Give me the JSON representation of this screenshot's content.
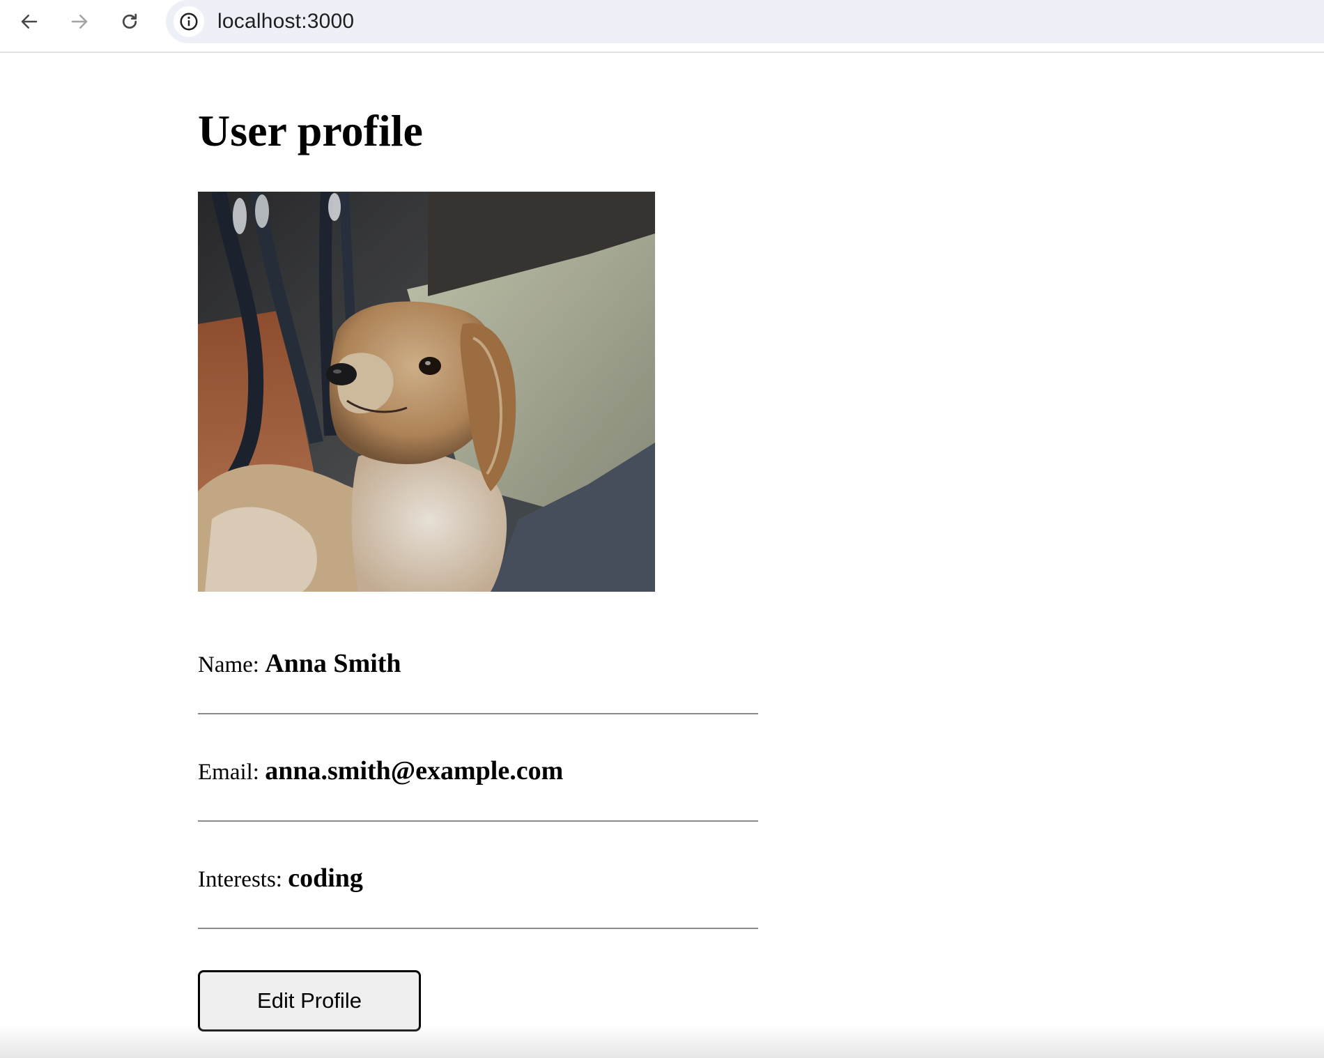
{
  "browser": {
    "url": "localhost:3000",
    "back_icon": "arrow-left-icon",
    "forward_icon": "arrow-right-icon",
    "reload_icon": "reload-icon",
    "site_info_icon": "info-icon"
  },
  "page": {
    "title": "User profile",
    "avatar_subject": "dog-photo",
    "fields": [
      {
        "label": "Name:",
        "value": "Anna Smith"
      },
      {
        "label": "Email:",
        "value": "anna.smith@example.com"
      },
      {
        "label": "Interests:",
        "value": "coding"
      }
    ],
    "edit_button_label": "Edit Profile"
  },
  "colors": {
    "omnibox_bg": "#edf1f7",
    "button_bg": "#efefef",
    "divider": "#8a8a8a"
  }
}
